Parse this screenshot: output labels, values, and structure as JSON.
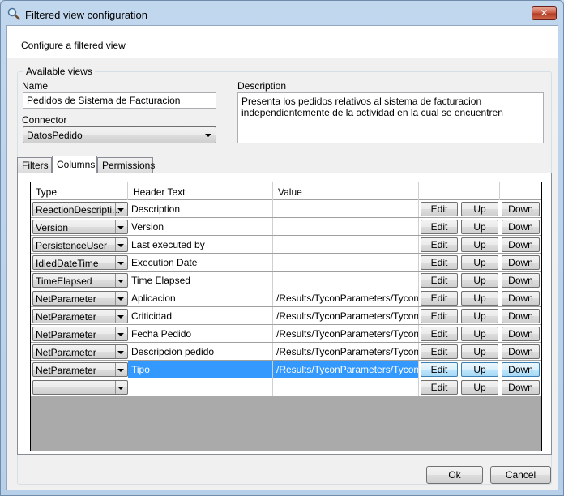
{
  "window": {
    "title": "Filtered view configuration",
    "close_label": "✕"
  },
  "header": {
    "text": "Configure a filtered view"
  },
  "available_views": {
    "group_title": "Available views",
    "name_label": "Name",
    "name_value": "Pedidos de Sistema de Facturacion",
    "connector_label": "Connector",
    "connector_value": "DatosPedido",
    "description_label": "Description",
    "description_value": "Presenta los pedidos relativos al sistema de facturacion independientemente de la actividad en la cual se encuentren"
  },
  "tabs": [
    {
      "label": "Filters"
    },
    {
      "label": "Columns"
    },
    {
      "label": "Permissions"
    }
  ],
  "active_tab": "Columns",
  "grid": {
    "headers": {
      "type": "Type",
      "header_text": "Header Text",
      "value": "Value"
    },
    "button_labels": {
      "edit": "Edit",
      "up": "Up",
      "down": "Down"
    },
    "rows": [
      {
        "type": "ReactionDescripti...",
        "header": "Description",
        "value": ""
      },
      {
        "type": "Version",
        "header": "Version",
        "value": ""
      },
      {
        "type": "PersistenceUser",
        "header": "Last executed by",
        "value": ""
      },
      {
        "type": "IdledDateTime",
        "header": "Execution Date",
        "value": ""
      },
      {
        "type": "TimeElapsed",
        "header": "Time Elapsed",
        "value": ""
      },
      {
        "type": "NetParameter",
        "header": "Aplicacion",
        "value": "/Results/TyconParameters/Tycon..."
      },
      {
        "type": "NetParameter",
        "header": "Criticidad",
        "value": "/Results/TyconParameters/Tycon..."
      },
      {
        "type": "NetParameter",
        "header": "Fecha Pedido",
        "value": "/Results/TyconParameters/Tycon..."
      },
      {
        "type": "NetParameter",
        "header": "Descripcion pedido",
        "value": "/Results/TyconParameters/Tycon..."
      },
      {
        "type": "NetParameter",
        "header": "Tipo",
        "value": "/Results/TyconParameters/Tycon...",
        "selected": true
      },
      {
        "type": "",
        "header": "",
        "value": ""
      }
    ]
  },
  "buttons": {
    "ok": "Ok",
    "cancel": "Cancel"
  },
  "colors": {
    "selection": "#3399ff",
    "grid_background": "#aaaaaa"
  }
}
